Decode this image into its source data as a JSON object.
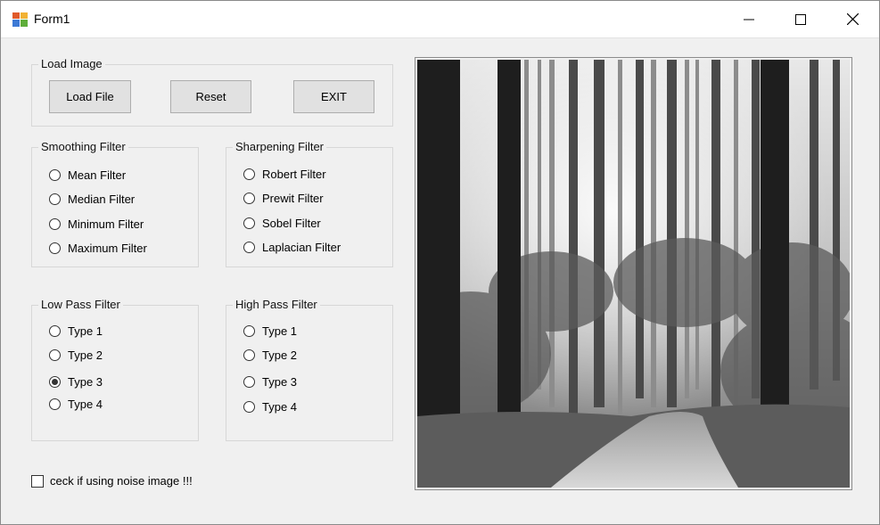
{
  "window": {
    "title": "Form1"
  },
  "load_group": {
    "label": "Load Image",
    "load_file": "Load File",
    "reset": "Reset",
    "exit": "EXIT"
  },
  "smoothing": {
    "label": "Smoothing Filter",
    "options": [
      "Mean Filter",
      "Median Filter",
      "Minimum Filter",
      "Maximum Filter"
    ]
  },
  "sharpening": {
    "label": "Sharpening Filter",
    "options": [
      "Robert Filter",
      "Prewit Filter",
      "Sobel Filter",
      "Laplacian Filter"
    ]
  },
  "low_pass": {
    "label": "Low Pass Filter",
    "options": [
      "Type 1",
      "Type 2",
      "Type 3",
      "Type 4"
    ],
    "selected": "Type 3"
  },
  "high_pass": {
    "label": "High Pass Filter",
    "options": [
      "Type 1",
      "Type 2",
      "Type 3",
      "Type 4"
    ]
  },
  "noise_check": {
    "label": "ceck if using noise image !!!",
    "checked": false
  },
  "icons": {
    "app": "app-form-icon",
    "minimize": "minimize-icon",
    "maximize": "maximize-icon",
    "close": "close-icon"
  },
  "picture": {
    "content": "grayscale-forest-photo"
  }
}
